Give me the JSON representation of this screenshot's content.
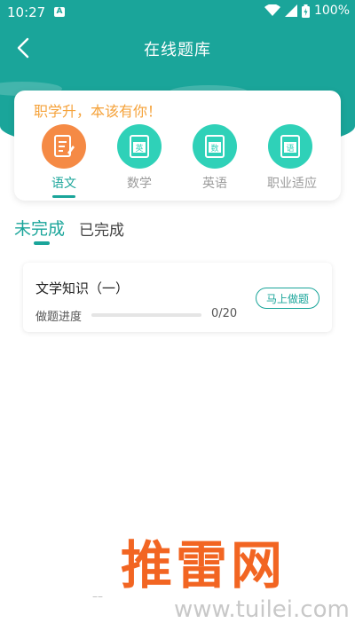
{
  "status_bar": {
    "time": "10:27",
    "app_badge": "A",
    "battery": "100%"
  },
  "header": {
    "title": "在线题库"
  },
  "subject_card": {
    "slogan": "职学升，本该有你！",
    "subjects": [
      {
        "label": "语文",
        "icon": "document-icon",
        "active": true
      },
      {
        "label": "数学",
        "icon": "book-math-icon",
        "badge": "数",
        "active": false
      },
      {
        "label": "英语",
        "icon": "book-english-icon",
        "badge": "英",
        "active": false
      },
      {
        "label": "职业适应",
        "icon": "book-career-icon",
        "badge": "语",
        "active": false
      }
    ]
  },
  "tabs": [
    {
      "label": "未完成",
      "active": true
    },
    {
      "label": "已完成",
      "active": false
    }
  ],
  "exercises": [
    {
      "title": "文学知识（一）",
      "progress_label": "做题进度",
      "progress_text": "0/20",
      "progress_fraction": 0,
      "action_label": "马上做题"
    }
  ],
  "watermark": {
    "brand": "推雷网",
    "url": "www.tuilei.com"
  },
  "colors": {
    "primary": "#1aa59a",
    "accent_orange": "#f58a45",
    "slogan": "#f5a23a",
    "icon_teal": "#2fd1b8"
  }
}
